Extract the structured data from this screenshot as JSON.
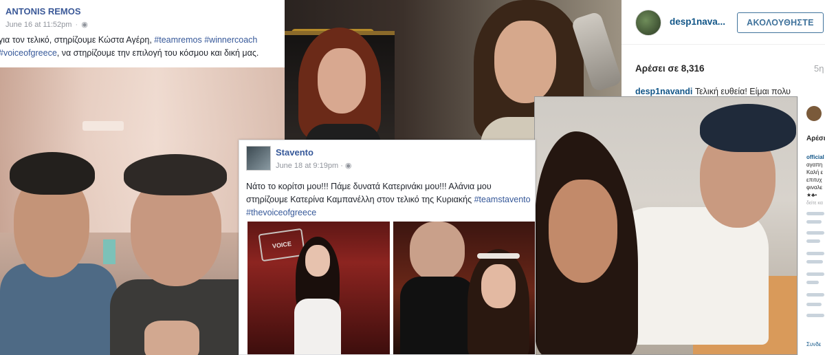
{
  "remos_post": {
    "author": "ANTONIS REMOS",
    "timestamp": "June 16 at 11:52pm",
    "caption_line1_prefix": "για τον τελικό, στηρίζουμε Κώστα Αγέρη, ",
    "caption_line1_tags": "#teamremos #winnercoach",
    "caption_line2_tag": "#voiceofgreece",
    "caption_line2_text": ", να στηρίζουμε την επιλογή του κόσμου και δική μας."
  },
  "instagram_top": {
    "username": "desp1nava...",
    "follow_label": "ΑΚΟΛΟΥΘΗΣΤΕ",
    "likes": "Αρέσει σε 8,316",
    "age": "5η",
    "comment_user": "desp1navandi",
    "comment_text": " Τελική ευθεία! Είμαι πολυ"
  },
  "stavento_post": {
    "author": "Stavento",
    "timestamp": "June 18 at 9:19pm",
    "caption_line1": "Νάτο το κορίτσι μου!!! Πάμε δυνατά Κατερινάκι μου!!! Αλάνια μου",
    "caption_line2_text": "στηρίζουμε Κατερίνα Καμπανέλλη στον τελικό της Κυριακής ",
    "caption_line2_tag": "#teamstavento",
    "caption_line3_tag": "#thevoiceofgreece"
  },
  "instagram_side": {
    "likes": "Αρέσει",
    "line1_user": "official",
    "line2": "αγαπη",
    "line3": "Καλή ε",
    "line4": "επιτυχ",
    "line5": "φιναλε",
    "line6": "★♣•",
    "more": "δείτε κα",
    "bottom": "Συνδε"
  },
  "colors": {
    "fb_link": "#365899",
    "fb_author": "#3b5998",
    "ig_link": "#125688",
    "ig_follow": "#3f729b"
  }
}
